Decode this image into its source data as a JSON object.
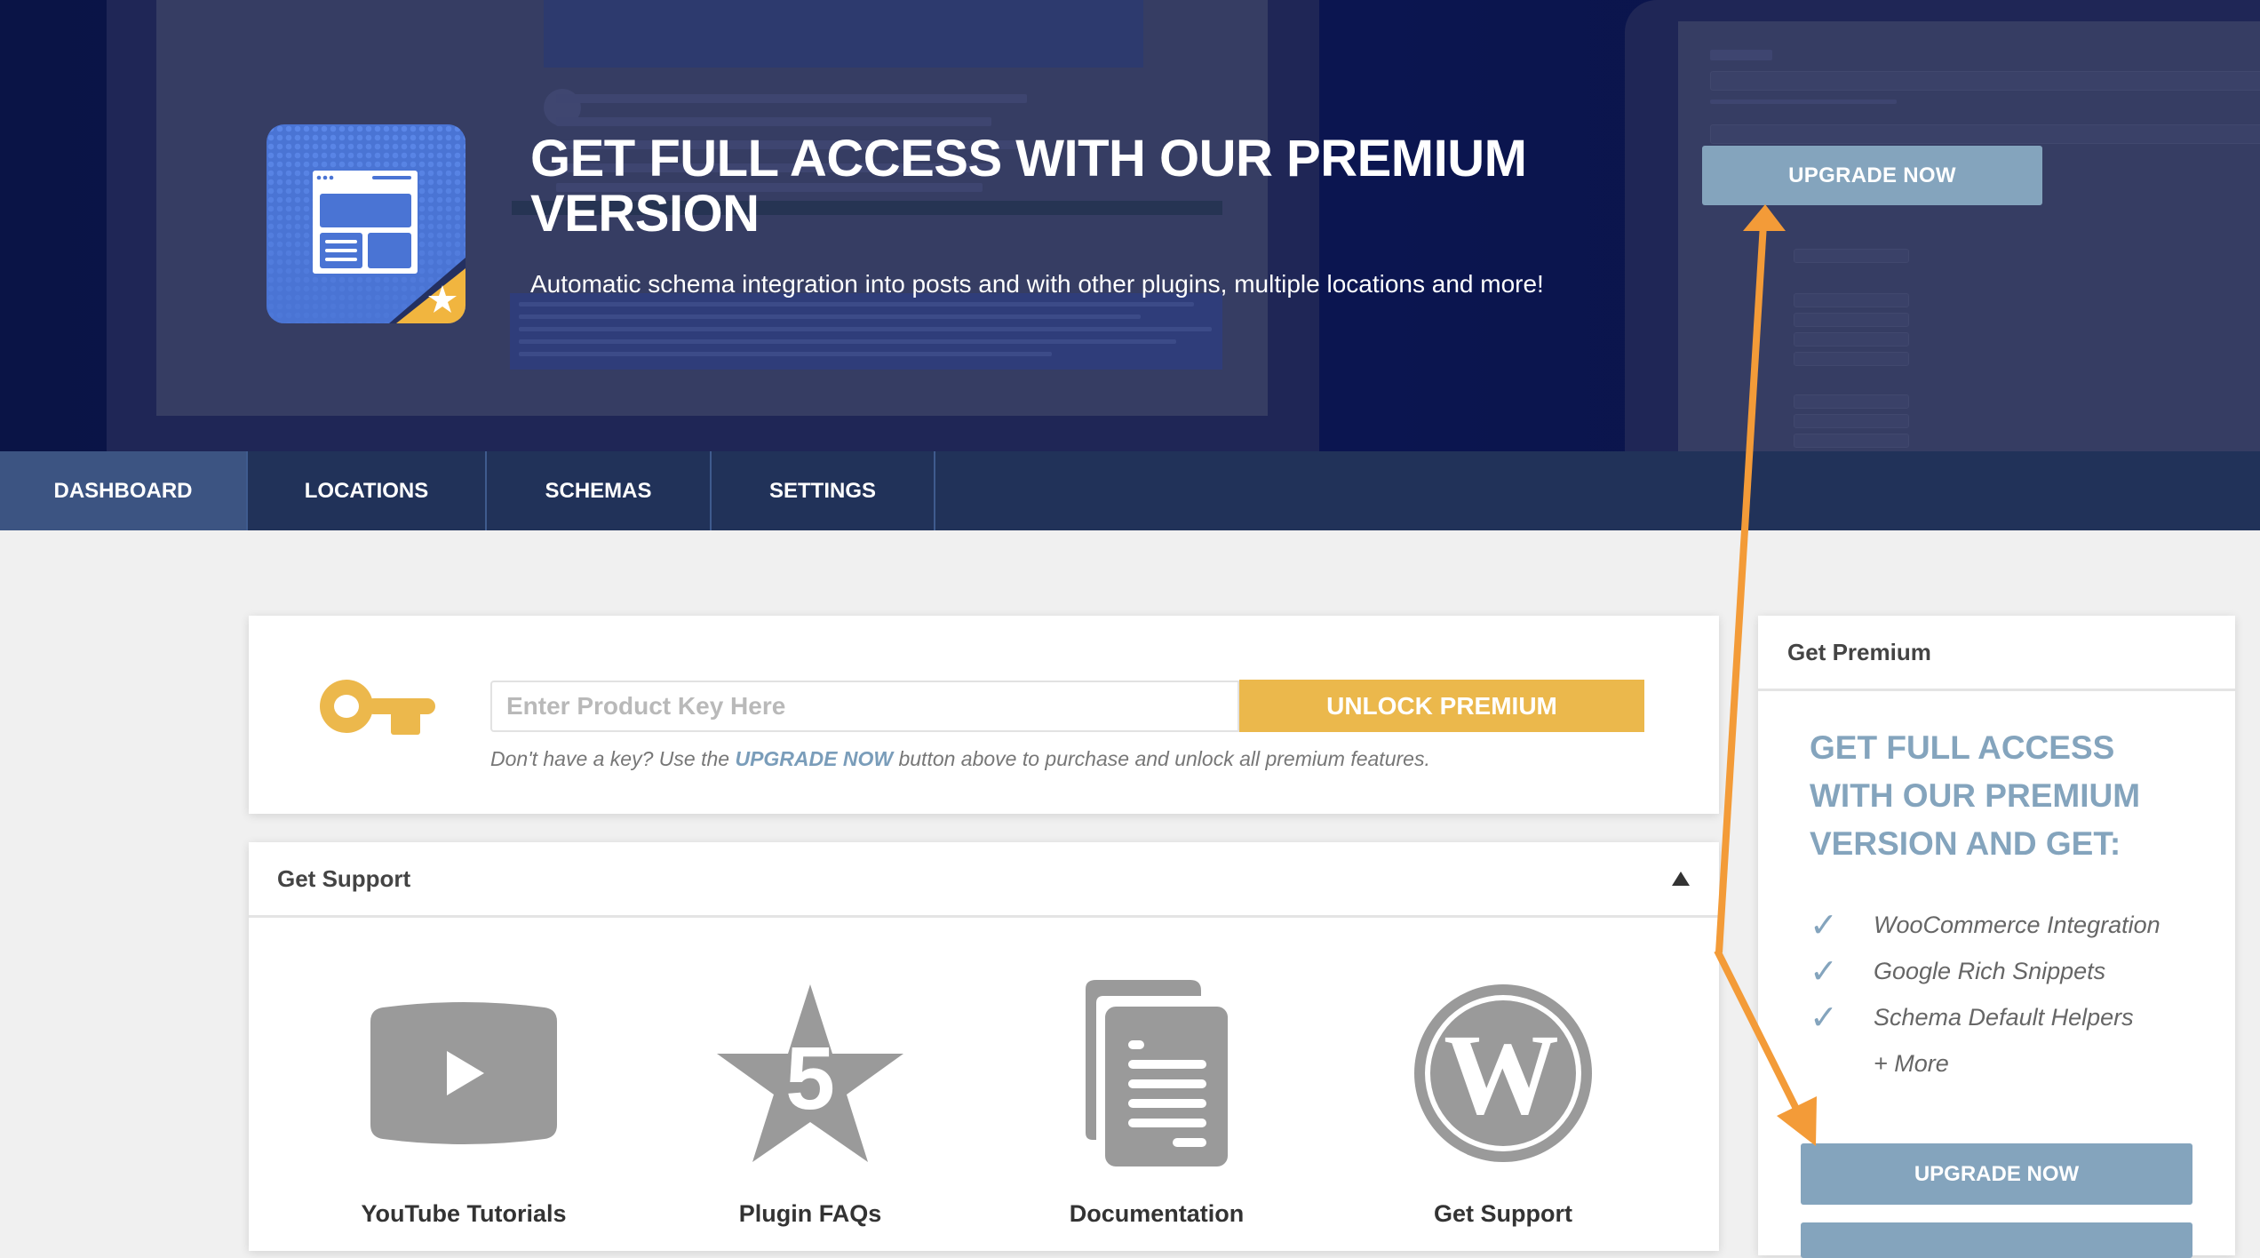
{
  "banner": {
    "title": "GET FULL ACCESS WITH OUR PREMIUM VERSION",
    "subtitle": "Automatic schema integration into posts and with other plugins, multiple locations and more!",
    "upgrade_label": "UPGRADE NOW",
    "logo_icon": "schema-layout-star-icon"
  },
  "nav": {
    "tabs": [
      {
        "label": "DASHBOARD",
        "active": true
      },
      {
        "label": "LOCATIONS",
        "active": false
      },
      {
        "label": "SCHEMAS",
        "active": false
      },
      {
        "label": "SETTINGS",
        "active": false
      }
    ]
  },
  "license": {
    "icon": "key-icon",
    "input_placeholder": "Enter Product Key Here",
    "input_value": "",
    "unlock_label": "UNLOCK PREMIUM",
    "hint_before": "Don't have a key? Use the ",
    "hint_link": "UPGRADE NOW",
    "hint_after": " button above to purchase and unlock all premium features."
  },
  "support": {
    "title": "Get Support",
    "collapse_icon": "triangle-up-icon",
    "items": [
      {
        "label": "YouTube Tutorials",
        "icon": "youtube-icon"
      },
      {
        "label": "Plugin FAQs",
        "icon": "star-five-icon"
      },
      {
        "label": "Documentation",
        "icon": "documents-icon"
      },
      {
        "label": "Get Support",
        "icon": "wordpress-icon"
      }
    ]
  },
  "premium": {
    "header": "Get Premium",
    "title": "GET FULL ACCESS WITH OUR PREMIUM VERSION AND GET:",
    "features": [
      "WooCommerce Integration",
      "Google Rich Snippets",
      "Schema Default Helpers"
    ],
    "more": "+ More",
    "upgrade_label": "UPGRADE NOW"
  },
  "colors": {
    "accent_blue": "#84a4bd",
    "unlock_yellow": "#ebb84c",
    "nav_bg": "#213259",
    "nav_active": "#3c5482",
    "banner_bg": "#0a1446",
    "annotation_arrow": "#f39b38"
  }
}
